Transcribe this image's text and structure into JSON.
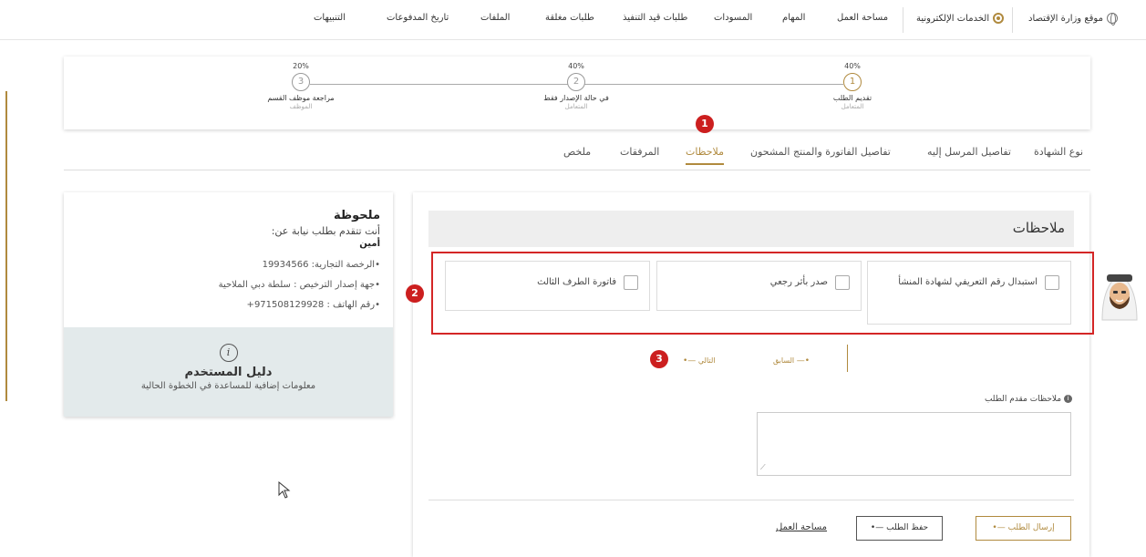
{
  "topnav": {
    "ministry_site": "موقع وزارة الإقتصاد",
    "eservices": "الخدمات الإلكترونية",
    "items": [
      "مساحة العمل",
      "المهام",
      "المسودات",
      "طلبات قيد التنفيذ",
      "طلبات مغلقة",
      "الملفات",
      "تاريخ المدفوعات",
      "التنبيهات"
    ]
  },
  "steps": [
    {
      "pct": "40%",
      "num": "1",
      "name": "تقديم الطلب",
      "sub": "المتعامل",
      "active": true
    },
    {
      "pct": "40%",
      "num": "2",
      "name": "في حالة الإصدار فقط",
      "sub": "المتعامل",
      "active": false
    },
    {
      "pct": "20%",
      "num": "3",
      "name": "مراجعة موظف القسم",
      "sub": "الموظف",
      "active": false
    }
  ],
  "tabs": [
    "نوع الشهادة",
    "تفاصيل المرسل إليه",
    "تفاصيل الفاتورة والمنتج المشحون",
    "ملاحظات",
    "المرفقات",
    "ملخص"
  ],
  "active_tab": "ملاحظات",
  "markers": [
    "1",
    "2",
    "3"
  ],
  "note": {
    "title": "ملحوظة",
    "line1": "أنت تتقدم بطلب نيابة عن:",
    "line2": "أمين",
    "license": "الرخصة التجارية:  19934566",
    "authority": "جهة إصدار الترخيص :  سلطة دبي الملاحية",
    "phone": "رقم الهاتف :  971508129928+"
  },
  "guide": {
    "icon": "info-icon",
    "title": "دليل المستخدم",
    "desc": "معلومات إضافية للمساعدة في الخطوة الحالية"
  },
  "panel": {
    "title": "ملاحظات",
    "options": [
      "استبدال رقم التعريفي لشهادة المنشأ",
      "صدر بأثر رجعي",
      "فاتورة الطرف الثالث"
    ],
    "prev": "السابق",
    "next": "التالي",
    "notes_label": "ملاحظات مقدم الطلب",
    "notes_value": ""
  },
  "actions": {
    "send": "إرسال الطلب",
    "save": "حفظ الطلب",
    "workspace": "مساحة العمل"
  },
  "colors": {
    "accent": "#b08a3e",
    "marker": "#cc1f1f",
    "highlight_box": "#d42626"
  }
}
